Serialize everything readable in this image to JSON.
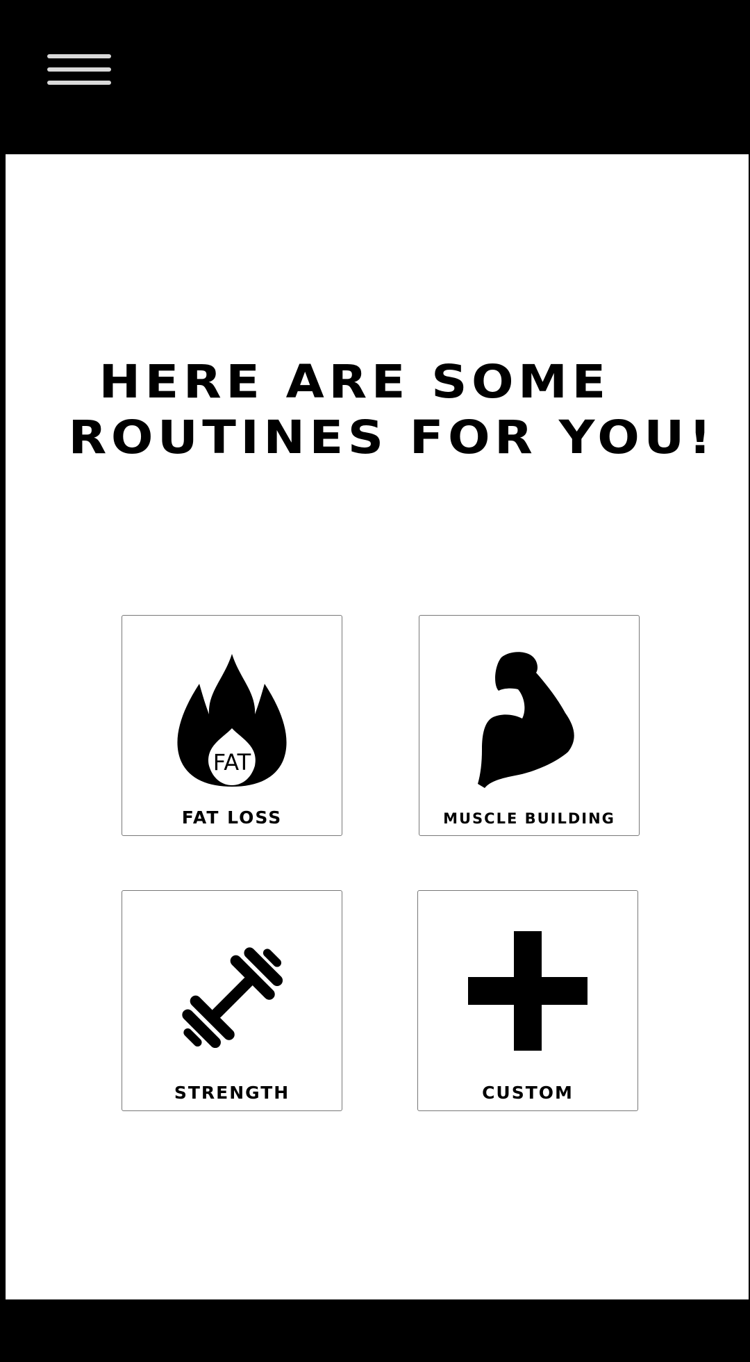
{
  "header": {
    "menu_icon": "hamburger-menu-icon"
  },
  "main": {
    "headline_line1": "HERE ARE SOME",
    "headline_line2": "ROUTINES FOR YOU!"
  },
  "routines": [
    {
      "label": "FAT LOSS",
      "icon": "flame-icon",
      "icon_text": "FAT"
    },
    {
      "label": "MUSCLE BUILDING",
      "icon": "flexed-bicep-icon"
    },
    {
      "label": "STRENGTH",
      "icon": "dumbbell-icon"
    },
    {
      "label": "CUSTOM",
      "icon": "plus-icon"
    }
  ],
  "colors": {
    "bar": "#000000",
    "background": "#ffffff",
    "menu_lines": "#d9d9d9",
    "card_border": "#777777"
  }
}
